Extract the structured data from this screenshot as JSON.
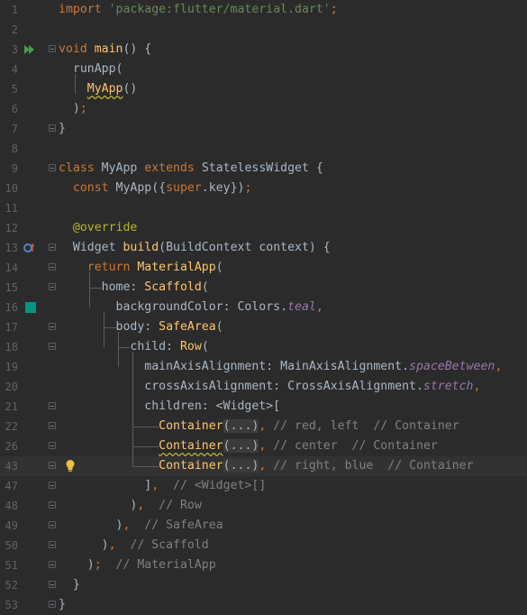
{
  "editor": {
    "lines": [
      {
        "num": "1",
        "segments": [
          [
            "kw",
            "import "
          ],
          [
            "str",
            "'package:flutter/material.dart'"
          ],
          [
            "kw",
            ";"
          ]
        ]
      },
      {
        "num": "2",
        "segments": []
      },
      {
        "num": "3",
        "gutter_icon": "run-icon",
        "fold": true,
        "segments": [
          [
            "kw",
            "void "
          ],
          [
            "fn",
            "main"
          ],
          [
            "cls",
            "() {"
          ]
        ]
      },
      {
        "num": "4",
        "segments": [
          [
            "cls",
            "  runApp("
          ]
        ]
      },
      {
        "num": "5",
        "segments": [
          [
            "cls",
            "    "
          ],
          [
            "fnw",
            "MyApp"
          ],
          [
            "cls",
            "()"
          ]
        ]
      },
      {
        "num": "6",
        "segments": [
          [
            "cls",
            "  )"
          ],
          [
            "kw",
            ";"
          ]
        ]
      },
      {
        "num": "7",
        "fold": true,
        "segments": [
          [
            "cls",
            "}"
          ]
        ]
      },
      {
        "num": "8",
        "segments": []
      },
      {
        "num": "9",
        "fold": true,
        "segments": [
          [
            "kw",
            "class "
          ],
          [
            "cls",
            "MyApp "
          ],
          [
            "kw",
            "extends "
          ],
          [
            "cls",
            "StatelessWidget {"
          ]
        ]
      },
      {
        "num": "10",
        "segments": [
          [
            "kw",
            "  const "
          ],
          [
            "cls",
            "MyApp({"
          ],
          [
            "kw",
            "super"
          ],
          [
            "cls",
            ".key})"
          ],
          [
            "kw",
            ";"
          ]
        ]
      },
      {
        "num": "11",
        "segments": []
      },
      {
        "num": "12",
        "segments": [
          [
            "ann",
            "  @override"
          ]
        ]
      },
      {
        "num": "13",
        "gutter_icon": "override-icon",
        "fold": true,
        "segments": [
          [
            "cls",
            "  Widget "
          ],
          [
            "fn",
            "build"
          ],
          [
            "cls",
            "(BuildContext context) {"
          ]
        ]
      },
      {
        "num": "14",
        "fold": true,
        "segments": [
          [
            "kw",
            "    return "
          ],
          [
            "fn",
            "MaterialApp"
          ],
          [
            "cls",
            "("
          ]
        ]
      },
      {
        "num": "15",
        "fold": true,
        "segments": [
          [
            "cls",
            "      home: "
          ],
          [
            "fn",
            "Scaffold"
          ],
          [
            "cls",
            "("
          ]
        ]
      },
      {
        "num": "16",
        "gutter_icon": "color-swatch-icon",
        "segments": [
          [
            "cls",
            "        backgroundColor: Colors."
          ],
          [
            "field",
            "teal"
          ],
          [
            "kw",
            ","
          ]
        ]
      },
      {
        "num": "17",
        "fold": true,
        "segments": [
          [
            "cls",
            "        body: "
          ],
          [
            "fn",
            "SafeArea"
          ],
          [
            "cls",
            "("
          ]
        ]
      },
      {
        "num": "18",
        "fold": true,
        "segments": [
          [
            "cls",
            "          child: "
          ],
          [
            "fn",
            "Row"
          ],
          [
            "cls",
            "("
          ]
        ]
      },
      {
        "num": "19",
        "segments": [
          [
            "cls",
            "            mainAxisAlignment: MainAxisAlignment."
          ],
          [
            "field",
            "spaceBetween"
          ],
          [
            "kw",
            ","
          ]
        ]
      },
      {
        "num": "20",
        "segments": [
          [
            "cls",
            "            crossAxisAlignment: CrossAxisAlignment."
          ],
          [
            "field",
            "stretch"
          ],
          [
            "kw",
            ","
          ]
        ]
      },
      {
        "num": "21",
        "fold": true,
        "segments": [
          [
            "cls",
            "            children: <Widget>["
          ]
        ]
      },
      {
        "num": "22",
        "fold": true,
        "segments": [
          [
            "cls",
            "              "
          ],
          [
            "fn",
            "Container"
          ],
          [
            "fr",
            "(...)"
          ],
          [
            "kw",
            ", "
          ],
          [
            "cmt",
            "// red, left  // Container"
          ]
        ]
      },
      {
        "num": "26",
        "fold": true,
        "segments": [
          [
            "cls",
            "              "
          ],
          [
            "fnw",
            "Container"
          ],
          [
            "fr",
            "(...)"
          ],
          [
            "kw",
            ", "
          ],
          [
            "cmt",
            "// center  // Container"
          ]
        ]
      },
      {
        "num": "43",
        "fold": true,
        "current": true,
        "bulb": true,
        "segments": [
          [
            "cls",
            "              "
          ],
          [
            "fn",
            "Container"
          ],
          [
            "fr",
            "(...)"
          ],
          [
            "kw",
            ", "
          ],
          [
            "cmt",
            "// right, blue  // Container"
          ]
        ]
      },
      {
        "num": "47",
        "fold": true,
        "segments": [
          [
            "cls",
            "            ]"
          ],
          [
            "kw",
            ",  "
          ],
          [
            "cmt",
            "// <Widget>[]"
          ]
        ]
      },
      {
        "num": "48",
        "fold": true,
        "segments": [
          [
            "cls",
            "          )"
          ],
          [
            "kw",
            ",  "
          ],
          [
            "cmt",
            "// Row"
          ]
        ]
      },
      {
        "num": "49",
        "fold": true,
        "segments": [
          [
            "cls",
            "        )"
          ],
          [
            "kw",
            ",  "
          ],
          [
            "cmt",
            "// SafeArea"
          ]
        ]
      },
      {
        "num": "50",
        "fold": true,
        "segments": [
          [
            "cls",
            "      )"
          ],
          [
            "kw",
            ",  "
          ],
          [
            "cmt",
            "// Scaffold"
          ]
        ]
      },
      {
        "num": "51",
        "fold": true,
        "segments": [
          [
            "cls",
            "    )"
          ],
          [
            "kw",
            ";  "
          ],
          [
            "cmt",
            "// MaterialApp"
          ]
        ]
      },
      {
        "num": "52",
        "fold": true,
        "segments": [
          [
            "cls",
            "  }"
          ]
        ]
      },
      {
        "num": "53",
        "fold": true,
        "segments": [
          [
            "cls",
            "}"
          ]
        ]
      }
    ]
  },
  "colors": {
    "background": "#2b2b2b",
    "keyword": "#cc7832",
    "string": "#6a8759",
    "function": "#ffc66d",
    "comment": "#808080",
    "field": "#9876aa",
    "annotation": "#bbb529",
    "teal_swatch": "#009688",
    "run_icon": "#499c54"
  }
}
